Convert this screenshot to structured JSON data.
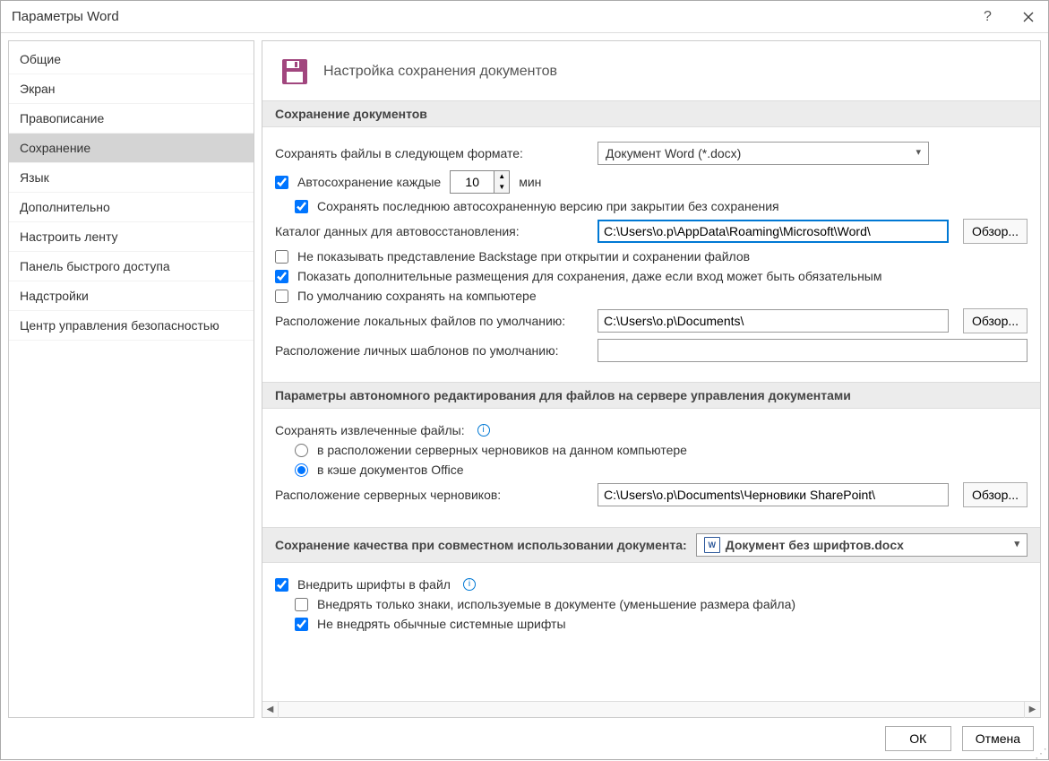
{
  "title": "Параметры Word",
  "nav": {
    "items": [
      "Общие",
      "Экран",
      "Правописание",
      "Сохранение",
      "Язык",
      "Дополнительно",
      "Настроить ленту",
      "Панель быстрого доступа",
      "Надстройки",
      "Центр управления безопасностью"
    ],
    "selectedIndex": 3
  },
  "header": {
    "text": "Настройка сохранения документов"
  },
  "sections": {
    "saveDocs": {
      "title": "Сохранение документов",
      "formatLabel": "Сохранять файлы в следующем формате:",
      "formatValue": "Документ Word (*.docx)",
      "autosaveChecked": true,
      "autosaveLabel": "Автосохранение каждые",
      "autosaveValue": "10",
      "autosaveUnit": "мин",
      "keepLastChecked": true,
      "keepLastLabel": "Сохранять последнюю автосохраненную версию при закрытии без сохранения",
      "autoRecoverDirLabel": "Каталог данных для автовосстановления:",
      "autoRecoverDirValue": "C:\\Users\\o.p\\AppData\\Roaming\\Microsoft\\Word\\",
      "noBackstageChecked": false,
      "noBackstageLabel": "Не показывать представление Backstage при открытии и сохранении файлов",
      "showAdditionalChecked": true,
      "showAdditionalLabel": "Показать дополнительные размещения для сохранения, даже если вход может быть обязательным",
      "defaultLocalChecked": false,
      "defaultLocalLabel": "По умолчанию сохранять на компьютере",
      "defaultLocDirLabel": "Расположение локальных файлов по умолчанию:",
      "defaultLocDirValue": "C:\\Users\\o.p\\Documents\\",
      "personalTplLabel": "Расположение личных шаблонов по умолчанию:",
      "personalTplValue": "",
      "browse": "Обзор..."
    },
    "offline": {
      "title": "Параметры автономного редактирования для файлов на сервере управления документами",
      "saveCheckedOutLabel": "Сохранять извлеченные файлы:",
      "optServerDrafts": "в расположении серверных черновиков на данном компьютере",
      "optOfficeCache": "в кэше документов Office",
      "selected": "cache",
      "draftsLocLabel": "Расположение серверных черновиков:",
      "draftsLocValue": "C:\\Users\\o.p\\Documents\\Черновики SharePoint\\",
      "browse": "Обзор..."
    },
    "quality": {
      "title": "Сохранение качества при совместном использовании документа:",
      "docValue": "Документ без шрифтов.docx",
      "embedFontsChecked": true,
      "embedFontsLabel": "Внедрить шрифты в файл",
      "onlyUsedChecked": false,
      "onlyUsedLabel": "Внедрять только знаки, используемые в документе (уменьшение размера файла)",
      "noCommonChecked": true,
      "noCommonLabel": "Не внедрять обычные системные шрифты"
    }
  },
  "buttons": {
    "ok": "ОК",
    "cancel": "Отмена"
  }
}
